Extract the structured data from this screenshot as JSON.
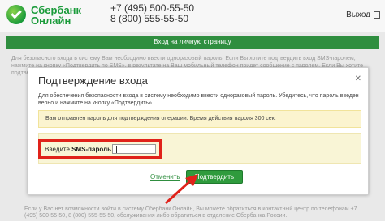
{
  "header": {
    "brand_line1": "Сбербанк",
    "brand_line2": "Онлайн",
    "phone1": "+7 (495) 500-55-50",
    "phone2": "8 (800) 555-55-50",
    "logout_label": "Выход"
  },
  "page": {
    "green_title": "Вход на личную страницу",
    "background_text": "Для безопасного входа в систему Вам необходимо ввести одноразовый пароль. Если Вы хотите подтвердить вход SMS-паролем, нажмите на кнопку «Подтвердить по SMS», в результате на Ваш мобильный телефон придет сообщение с паролем. Если Вы хотите подтвердить вход с помощью одноразового пароля с чека, нажмите на кнопку «Подтвердить»",
    "background_bottom_text": "Если у Вас нет возможности войти в систему Сбербанк Онлайн, Вы можете обратиться в контактный центр по телефонам +7 (495) 500-55-50, 8 (800) 555-55-50, обслуживания либо обратиться в отделение Сбербанка России."
  },
  "modal": {
    "title": "Подтверждение входа",
    "close_label": "✕",
    "description": "Для обеспечения безопасности входа в систему необходимо ввести одноразовый пароль. Убедитесь, что пароль введен верно и нажмите на кнопку «Подтвердить».",
    "notice": "Вам отправлен пароль для подтверждения операции. Время действия пароля 300 сек.",
    "sms_label_prefix": "Введите ",
    "sms_label_bold": "SMS-пароль",
    "sms_label_suffix": " :",
    "sms_value": "",
    "cancel_label": "Отменить",
    "confirm_label": "Подтвердить"
  },
  "colors": {
    "brand_green": "#2f8e3f",
    "highlight_red": "#e0221a",
    "notice_bg": "#fbf4cf"
  }
}
